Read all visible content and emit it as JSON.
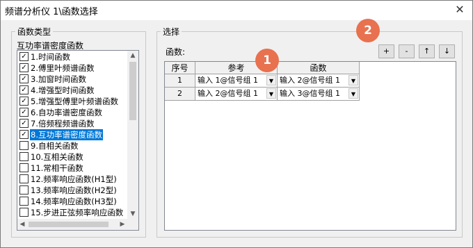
{
  "window": {
    "title": "频谱分析仪 1\\函数选择",
    "close_glyph": "✕"
  },
  "func_type": {
    "legend": "函数类型",
    "selected_label": "互功率谱密度函数",
    "items": [
      {
        "label": "1.时间函数",
        "checked": true
      },
      {
        "label": "2.傅里叶频谱函数",
        "checked": true
      },
      {
        "label": "3.加窗时间函数",
        "checked": true
      },
      {
        "label": "4.增强型时间函数",
        "checked": true
      },
      {
        "label": "5.增强型傅里叶频谱函数",
        "checked": true
      },
      {
        "label": "6.自功率谱密度函数",
        "checked": true
      },
      {
        "label": "7.倍频程频谱函数",
        "checked": true
      },
      {
        "label": "8.互功率谱密度函数",
        "checked": true,
        "selected": true
      },
      {
        "label": "9.自相关函数",
        "checked": false
      },
      {
        "label": "10.互相关函数",
        "checked": false
      },
      {
        "label": "11.常相干函数",
        "checked": false
      },
      {
        "label": "12.频率响应函数(H1型)",
        "checked": false
      },
      {
        "label": "13.频率响应函数(H2型)",
        "checked": false
      },
      {
        "label": "14.频率响应函数(H3型)",
        "checked": false
      },
      {
        "label": "15.步进正弦频率响应函数",
        "checked": false
      }
    ]
  },
  "selection": {
    "legend": "选择",
    "func_label": "函数:",
    "buttons": {
      "add": "+",
      "remove": "-",
      "up": "↑",
      "down": "↓"
    },
    "columns": [
      "序号",
      "参考",
      "函数"
    ],
    "rows": [
      {
        "num": "1",
        "ref": "输入 1@信号组 1",
        "func": "输入 2@信号组 1"
      },
      {
        "num": "2",
        "ref": "输入 2@信号组 1",
        "func": "输入 3@信号组 1"
      }
    ]
  },
  "badges": [
    "1",
    "2"
  ],
  "colors": {
    "selection": "#0078d7",
    "badge": "#e8714f"
  }
}
